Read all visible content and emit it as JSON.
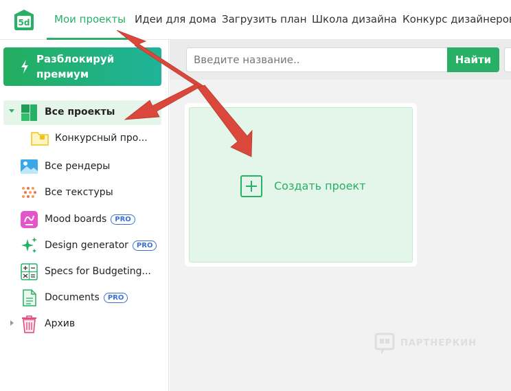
{
  "nav": {
    "logo_text": "5d",
    "items": [
      {
        "label": "Мои проекты",
        "active": true
      },
      {
        "label": "Идеи для дома"
      },
      {
        "label": "Загрузить план"
      },
      {
        "label": "Школа дизайна"
      },
      {
        "label": "Конкурс дизайнеров"
      }
    ]
  },
  "sidebar": {
    "premium": {
      "line1": "Разблокируй",
      "line2": "премиум"
    },
    "items": [
      {
        "label": "Все проекты",
        "icon": "all-projects-icon"
      },
      {
        "label": "Конкурсный про...",
        "icon": "folder-icon"
      },
      {
        "label": "Все рендеры",
        "icon": "renders-icon"
      },
      {
        "label": "Все текстуры",
        "icon": "textures-icon"
      },
      {
        "label": "Mood boards",
        "icon": "mood-boards-icon",
        "badge": "PRO"
      },
      {
        "label": "Design generator",
        "icon": "sparkle-icon",
        "badge": "PRO"
      },
      {
        "label": "Specs for Budgeting...",
        "icon": "calculator-icon"
      },
      {
        "label": "Documents",
        "icon": "document-icon",
        "badge": "PRO"
      },
      {
        "label": "Архив",
        "icon": "trash-icon"
      }
    ]
  },
  "main": {
    "search": {
      "placeholder": "Введите название..",
      "value": "",
      "button": "Найти"
    },
    "create_card": {
      "label": "Создать проект"
    },
    "watermark": "ПАРТНЕРКИН"
  },
  "colors": {
    "accent": "#27b066",
    "pro": "#3b6fd6",
    "annotation_arrow": "#d9483b"
  }
}
